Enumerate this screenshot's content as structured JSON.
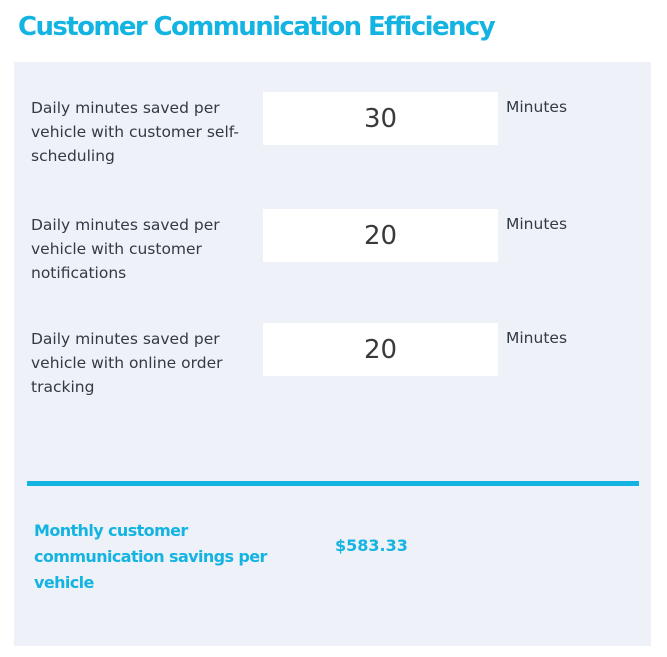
{
  "title": "Customer Communication Efficiency",
  "rows": [
    {
      "label": "Daily minutes saved per vehicle with customer self-scheduling",
      "value": "30",
      "unit": "Minutes"
    },
    {
      "label": "Daily minutes saved per vehicle with customer notifications",
      "value": "20",
      "unit": "Minutes"
    },
    {
      "label": "Daily minutes saved per vehicle with online order tracking",
      "value": "20",
      "unit": "Minutes"
    }
  ],
  "result": {
    "label": "Monthly customer communication savings per vehicle",
    "value": "$583.33"
  },
  "colors": {
    "accent": "#14b4e2",
    "panel": "#eef1f8",
    "text": "#333a44"
  }
}
